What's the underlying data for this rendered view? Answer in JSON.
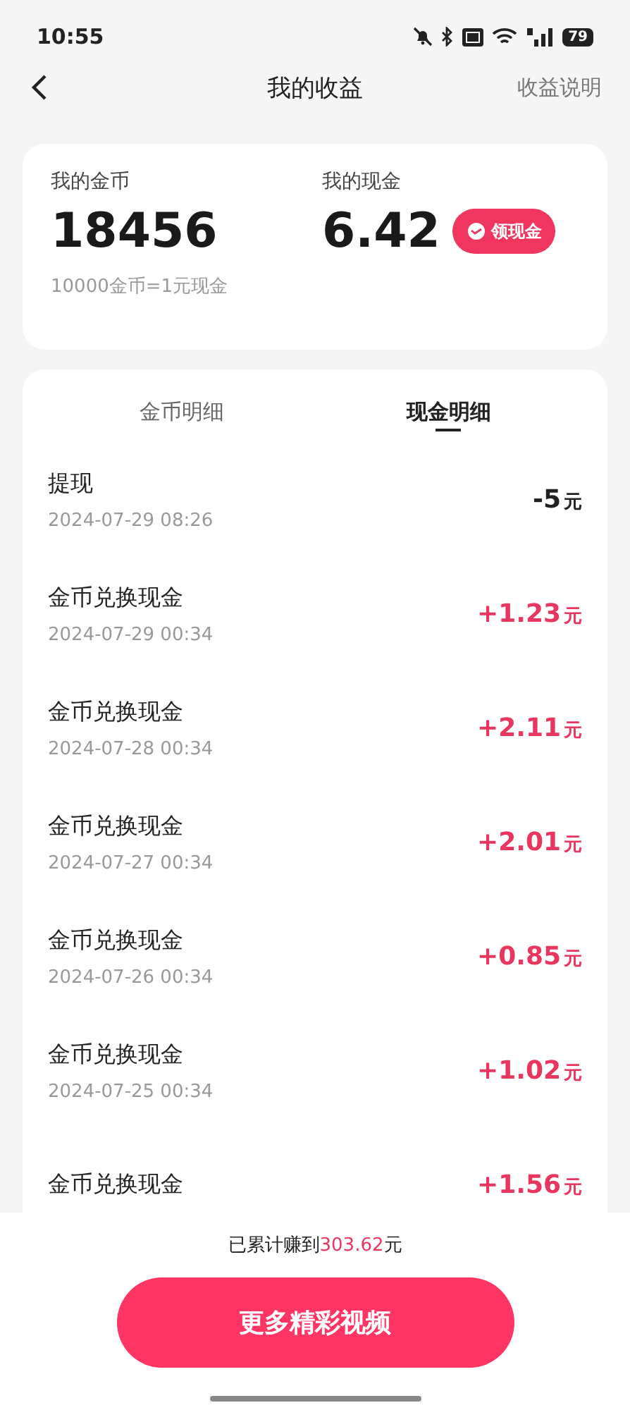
{
  "status_bar": {
    "time": "10:55",
    "battery": "79"
  },
  "header": {
    "title": "我的收益",
    "link": "收益说明"
  },
  "summary": {
    "coins_label": "我的金币",
    "coins": "18456",
    "rate": "10000金币=1元现金",
    "cash_label": "我的现金",
    "cash": "6.42",
    "claim_button": "领现金"
  },
  "tabs": [
    {
      "label": "金币明细",
      "selected": false
    },
    {
      "label": "现金明细",
      "selected": true
    }
  ],
  "records": [
    {
      "kind": "withdraw",
      "title": "提现",
      "date": "2024-07-29 08:26",
      "amount": "-5",
      "unit": "元"
    },
    {
      "kind": "exchange",
      "title": "金币兑换现金",
      "date": "2024-07-29 00:34",
      "amount": "+1.23",
      "unit": "元"
    },
    {
      "kind": "exchange",
      "title": "金币兑换现金",
      "date": "2024-07-28 00:34",
      "amount": "+2.11",
      "unit": "元"
    },
    {
      "kind": "exchange",
      "title": "金币兑换现金",
      "date": "2024-07-27 00:34",
      "amount": "+2.01",
      "unit": "元"
    },
    {
      "kind": "exchange",
      "title": "金币兑换现金",
      "date": "2024-07-26 00:34",
      "amount": "+0.85",
      "unit": "元"
    },
    {
      "kind": "exchange",
      "title": "金币兑换现金",
      "date": "2024-07-25 00:34",
      "amount": "+1.02",
      "unit": "元"
    },
    {
      "kind": "exchange",
      "title": "金币兑换现金",
      "amount": "+1.56",
      "unit": "元"
    }
  ],
  "footer": {
    "total_prefix": "已累计赚到",
    "total": "303.62",
    "total_unit": "元",
    "button": "更多精彩视频"
  }
}
